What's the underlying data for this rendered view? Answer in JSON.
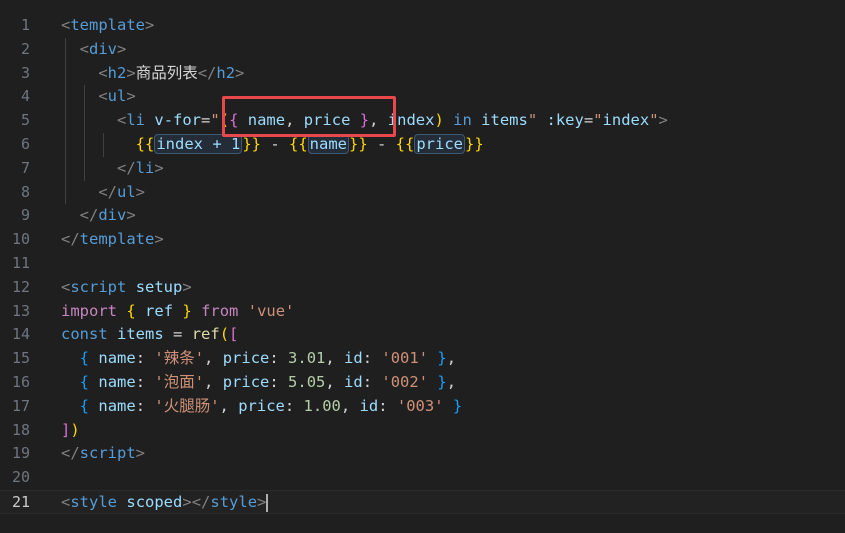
{
  "editor": {
    "current_line": "21",
    "lines": [
      {
        "n": "1",
        "tokens": [
          {
            "t": "<",
            "c": "tag-p"
          },
          {
            "t": "template",
            "c": "tag"
          },
          {
            "t": ">",
            "c": "tag-p"
          }
        ]
      },
      {
        "n": "2",
        "tokens": [
          {
            "t": "  ",
            "c": "txt"
          },
          {
            "t": "<",
            "c": "tag-p"
          },
          {
            "t": "div",
            "c": "tag"
          },
          {
            "t": ">",
            "c": "tag-p"
          }
        ]
      },
      {
        "n": "3",
        "tokens": [
          {
            "t": "    ",
            "c": "txt"
          },
          {
            "t": "<",
            "c": "tag-p"
          },
          {
            "t": "h2",
            "c": "tag"
          },
          {
            "t": ">",
            "c": "tag-p"
          },
          {
            "t": "商品列表",
            "c": "txt"
          },
          {
            "t": "</",
            "c": "tag-p"
          },
          {
            "t": "h2",
            "c": "tag"
          },
          {
            "t": ">",
            "c": "tag-p"
          }
        ]
      },
      {
        "n": "4",
        "tokens": [
          {
            "t": "    ",
            "c": "txt"
          },
          {
            "t": "<",
            "c": "tag-p"
          },
          {
            "t": "ul",
            "c": "tag"
          },
          {
            "t": ">",
            "c": "tag-p"
          }
        ]
      },
      {
        "n": "5",
        "tokens": [
          {
            "t": "      ",
            "c": "txt"
          },
          {
            "t": "<",
            "c": "tag-p"
          },
          {
            "t": "li",
            "c": "tag"
          },
          {
            "t": " ",
            "c": "txt"
          },
          {
            "t": "v-for",
            "c": "attr"
          },
          {
            "t": "=",
            "c": "txt"
          },
          {
            "t": "\"",
            "c": "str"
          },
          {
            "t": "(",
            "c": "b1"
          },
          {
            "t": "{",
            "c": "b2"
          },
          {
            "t": " ",
            "c": "txt"
          },
          {
            "t": "name",
            "c": "var"
          },
          {
            "t": ", ",
            "c": "txt"
          },
          {
            "t": "price",
            "c": "var"
          },
          {
            "t": " ",
            "c": "txt"
          },
          {
            "t": "}",
            "c": "b2"
          },
          {
            "t": ", ",
            "c": "txt"
          },
          {
            "t": "index",
            "c": "var"
          },
          {
            "t": ")",
            "c": "b1"
          },
          {
            "t": " ",
            "c": "txt"
          },
          {
            "t": "in",
            "c": "kw2"
          },
          {
            "t": " ",
            "c": "txt"
          },
          {
            "t": "items",
            "c": "var"
          },
          {
            "t": "\"",
            "c": "str"
          },
          {
            "t": " ",
            "c": "txt"
          },
          {
            "t": ":key",
            "c": "attr"
          },
          {
            "t": "=",
            "c": "txt"
          },
          {
            "t": "\"",
            "c": "str"
          },
          {
            "t": "index",
            "c": "var"
          },
          {
            "t": "\"",
            "c": "str"
          },
          {
            "t": ">",
            "c": "tag-p"
          }
        ]
      },
      {
        "n": "6",
        "tokens": [
          {
            "t": "        ",
            "c": "txt"
          },
          {
            "t": "{{",
            "c": "b1"
          },
          {
            "t": "index + 1",
            "c": "var",
            "h": true
          },
          {
            "t": "}}",
            "c": "b1"
          },
          {
            "t": " - ",
            "c": "txt"
          },
          {
            "t": "{{",
            "c": "b1"
          },
          {
            "t": "name",
            "c": "var",
            "h": true
          },
          {
            "t": "}}",
            "c": "b1"
          },
          {
            "t": " - ",
            "c": "txt"
          },
          {
            "t": "{{",
            "c": "b1"
          },
          {
            "t": "price",
            "c": "var",
            "h": true
          },
          {
            "t": "}}",
            "c": "b1"
          }
        ]
      },
      {
        "n": "7",
        "tokens": [
          {
            "t": "      ",
            "c": "txt"
          },
          {
            "t": "</",
            "c": "tag-p"
          },
          {
            "t": "li",
            "c": "tag"
          },
          {
            "t": ">",
            "c": "tag-p"
          }
        ]
      },
      {
        "n": "8",
        "tokens": [
          {
            "t": "    ",
            "c": "txt"
          },
          {
            "t": "</",
            "c": "tag-p"
          },
          {
            "t": "ul",
            "c": "tag"
          },
          {
            "t": ">",
            "c": "tag-p"
          }
        ]
      },
      {
        "n": "9",
        "tokens": [
          {
            "t": "  ",
            "c": "txt"
          },
          {
            "t": "</",
            "c": "tag-p"
          },
          {
            "t": "div",
            "c": "tag"
          },
          {
            "t": ">",
            "c": "tag-p"
          }
        ]
      },
      {
        "n": "10",
        "tokens": [
          {
            "t": "</",
            "c": "tag-p"
          },
          {
            "t": "template",
            "c": "tag"
          },
          {
            "t": ">",
            "c": "tag-p"
          }
        ]
      },
      {
        "n": "11",
        "tokens": []
      },
      {
        "n": "12",
        "tokens": [
          {
            "t": "<",
            "c": "tag-p"
          },
          {
            "t": "script",
            "c": "tag"
          },
          {
            "t": " ",
            "c": "txt"
          },
          {
            "t": "setup",
            "c": "attr"
          },
          {
            "t": ">",
            "c": "tag-p"
          }
        ]
      },
      {
        "n": "13",
        "tokens": [
          {
            "t": "import",
            "c": "kw"
          },
          {
            "t": " ",
            "c": "txt"
          },
          {
            "t": "{",
            "c": "b1"
          },
          {
            "t": " ",
            "c": "txt"
          },
          {
            "t": "ref",
            "c": "var"
          },
          {
            "t": " ",
            "c": "txt"
          },
          {
            "t": "}",
            "c": "b1"
          },
          {
            "t": " ",
            "c": "txt"
          },
          {
            "t": "from",
            "c": "kw"
          },
          {
            "t": " ",
            "c": "txt"
          },
          {
            "t": "'vue'",
            "c": "str"
          }
        ]
      },
      {
        "n": "14",
        "tokens": [
          {
            "t": "const",
            "c": "kw2"
          },
          {
            "t": " ",
            "c": "txt"
          },
          {
            "t": "items",
            "c": "var"
          },
          {
            "t": " = ",
            "c": "txt"
          },
          {
            "t": "ref",
            "c": "fn"
          },
          {
            "t": "(",
            "c": "b1"
          },
          {
            "t": "[",
            "c": "b2"
          }
        ]
      },
      {
        "n": "15",
        "tokens": [
          {
            "t": "  ",
            "c": "txt"
          },
          {
            "t": "{",
            "c": "b3"
          },
          {
            "t": " ",
            "c": "txt"
          },
          {
            "t": "name",
            "c": "ident"
          },
          {
            "t": ": ",
            "c": "txt"
          },
          {
            "t": "'辣条'",
            "c": "str"
          },
          {
            "t": ", ",
            "c": "txt"
          },
          {
            "t": "price",
            "c": "ident"
          },
          {
            "t": ": ",
            "c": "txt"
          },
          {
            "t": "3.01",
            "c": "num"
          },
          {
            "t": ", ",
            "c": "txt"
          },
          {
            "t": "id",
            "c": "ident"
          },
          {
            "t": ": ",
            "c": "txt"
          },
          {
            "t": "'001'",
            "c": "str"
          },
          {
            "t": " ",
            "c": "txt"
          },
          {
            "t": "}",
            "c": "b3"
          },
          {
            "t": ",",
            "c": "txt"
          }
        ]
      },
      {
        "n": "16",
        "tokens": [
          {
            "t": "  ",
            "c": "txt"
          },
          {
            "t": "{",
            "c": "b3"
          },
          {
            "t": " ",
            "c": "txt"
          },
          {
            "t": "name",
            "c": "ident"
          },
          {
            "t": ": ",
            "c": "txt"
          },
          {
            "t": "'泡面'",
            "c": "str"
          },
          {
            "t": ", ",
            "c": "txt"
          },
          {
            "t": "price",
            "c": "ident"
          },
          {
            "t": ": ",
            "c": "txt"
          },
          {
            "t": "5.05",
            "c": "num"
          },
          {
            "t": ", ",
            "c": "txt"
          },
          {
            "t": "id",
            "c": "ident"
          },
          {
            "t": ": ",
            "c": "txt"
          },
          {
            "t": "'002'",
            "c": "str"
          },
          {
            "t": " ",
            "c": "txt"
          },
          {
            "t": "}",
            "c": "b3"
          },
          {
            "t": ",",
            "c": "txt"
          }
        ]
      },
      {
        "n": "17",
        "tokens": [
          {
            "t": "  ",
            "c": "txt"
          },
          {
            "t": "{",
            "c": "b3"
          },
          {
            "t": " ",
            "c": "txt"
          },
          {
            "t": "name",
            "c": "ident"
          },
          {
            "t": ": ",
            "c": "txt"
          },
          {
            "t": "'火腿肠'",
            "c": "str"
          },
          {
            "t": ", ",
            "c": "txt"
          },
          {
            "t": "price",
            "c": "ident"
          },
          {
            "t": ": ",
            "c": "txt"
          },
          {
            "t": "1.00",
            "c": "num"
          },
          {
            "t": ", ",
            "c": "txt"
          },
          {
            "t": "id",
            "c": "ident"
          },
          {
            "t": ": ",
            "c": "txt"
          },
          {
            "t": "'003'",
            "c": "str"
          },
          {
            "t": " ",
            "c": "txt"
          },
          {
            "t": "}",
            "c": "b3"
          }
        ]
      },
      {
        "n": "18",
        "tokens": [
          {
            "t": "]",
            "c": "b2"
          },
          {
            "t": ")",
            "c": "b1"
          }
        ]
      },
      {
        "n": "19",
        "tokens": [
          {
            "t": "</",
            "c": "tag-p"
          },
          {
            "t": "script",
            "c": "tag"
          },
          {
            "t": ">",
            "c": "tag-p"
          }
        ]
      },
      {
        "n": "20",
        "tokens": []
      },
      {
        "n": "21",
        "tokens": [
          {
            "t": "<",
            "c": "tag-p"
          },
          {
            "t": "style",
            "c": "tag"
          },
          {
            "t": " ",
            "c": "txt"
          },
          {
            "t": "scoped",
            "c": "attr"
          },
          {
            "t": ">",
            "c": "tag-p"
          },
          {
            "t": "</",
            "c": "tag-p"
          },
          {
            "t": "style",
            "c": "tag"
          },
          {
            "t": ">",
            "c": "tag-p"
          }
        ]
      }
    ]
  },
  "colors": {
    "background": "#1f1f1f",
    "highlight_box": "#e8484c"
  }
}
